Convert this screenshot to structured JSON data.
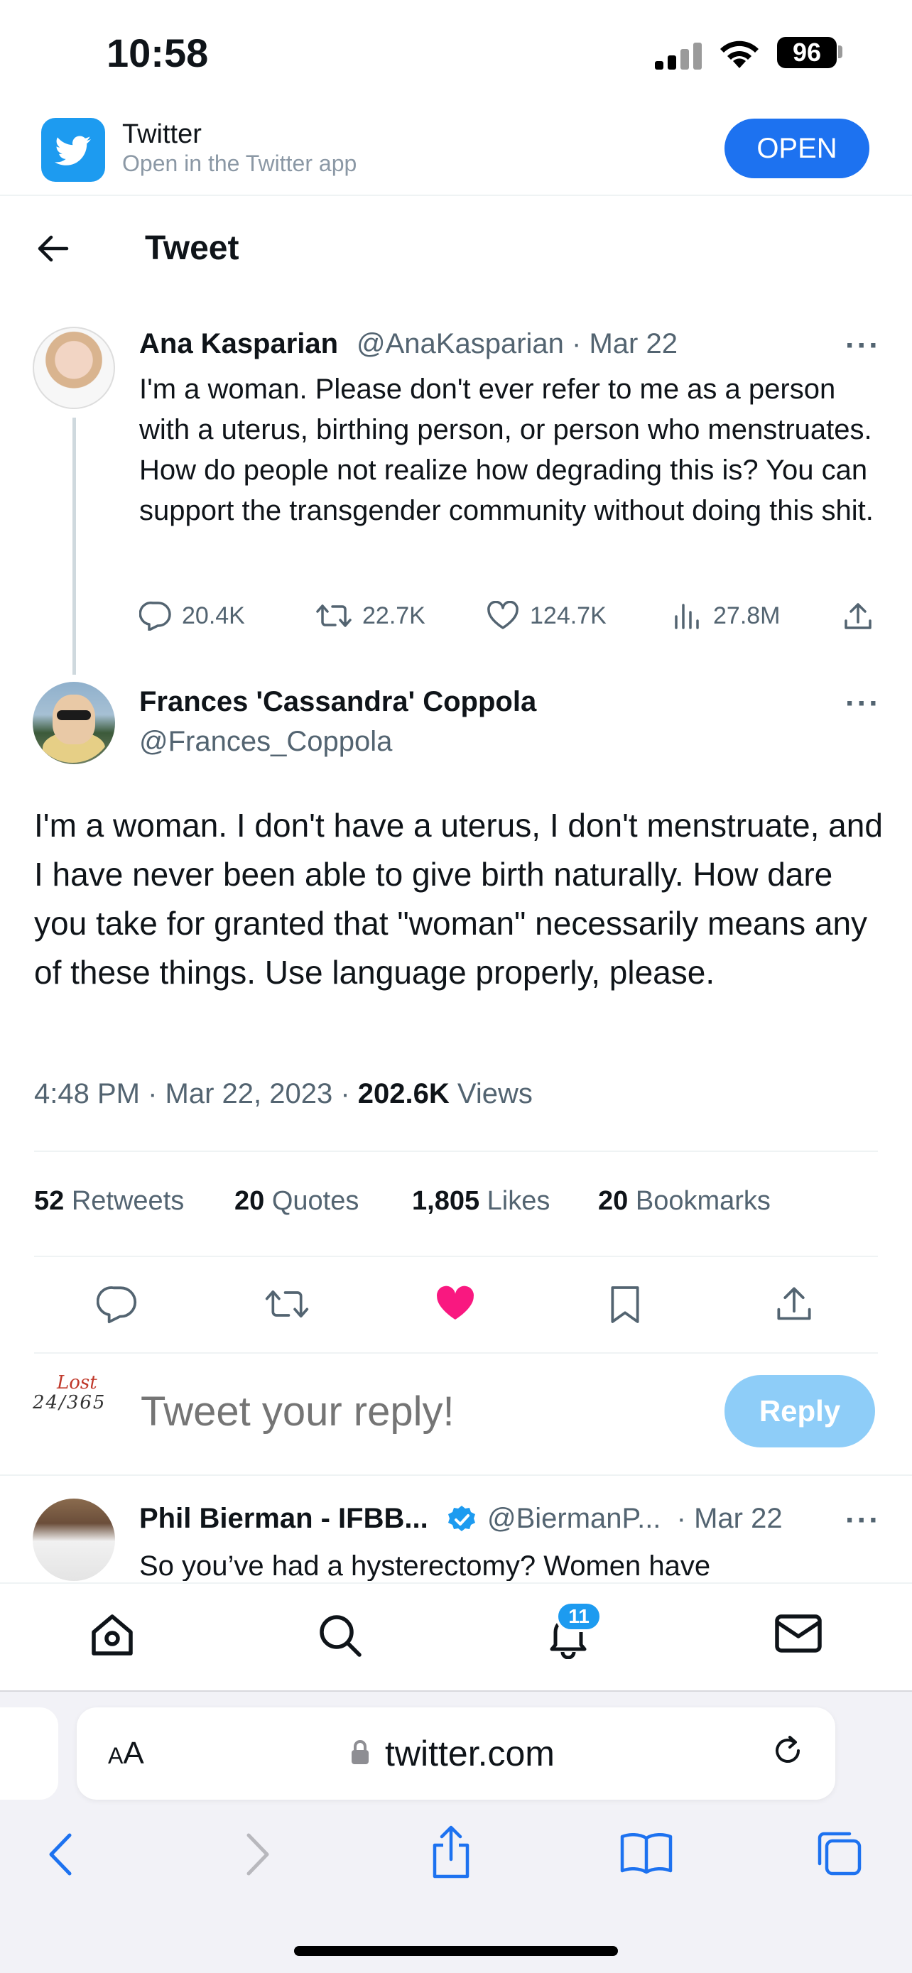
{
  "status_bar": {
    "time": "10:58",
    "battery": "96"
  },
  "banner": {
    "app_name": "Twitter",
    "subtitle": "Open in the Twitter app",
    "open_label": "OPEN"
  },
  "header": {
    "title": "Tweet"
  },
  "parent_tweet": {
    "name": "Ana Kasparian",
    "meta": "@AnaKasparian · Mar 22",
    "text": "I'm a woman. Please don't ever refer to me as a person with a uterus, birthing person, or person who menstruates. How do people not realize how degrading this is? You can support the transgender community without doing this shit.",
    "replies": "20.4K",
    "retweets": "22.7K",
    "likes": "124.7K",
    "views": "27.8M"
  },
  "main_tweet": {
    "name": "Frances 'Cassandra' Coppola",
    "handle": "@Frances_Coppola",
    "text": "I'm a woman. I don't have a uterus, I don't menstruate, and I have never been able to give birth naturally. How dare you take for granted that \"woman\" necessarily means any of these things. Use language properly, please.",
    "timestamp": "4:48 PM · Mar 22, 2023 · ",
    "views_count": "202.6K",
    "views_label": "Views",
    "stats": {
      "retweets_count": "52",
      "retweets_label": "Retweets",
      "quotes_count": "20",
      "quotes_label": "Quotes",
      "likes_count": "1,805",
      "likes_label": "Likes",
      "bookmarks_count": "20",
      "bookmarks_label": "Bookmarks"
    },
    "liked": true
  },
  "composer": {
    "placeholder": "Tweet your reply!",
    "reply_label": "Reply",
    "avatar_text_top": "Lost",
    "avatar_text_bottom": "24/365"
  },
  "reply_tweet": {
    "name": "Phil Bierman - IFBB...",
    "meta": "@BiermanP...  · Mar 22",
    "text": "So you’ve had a hysterectomy? Women have"
  },
  "bottom_nav": {
    "notification_count": "11"
  },
  "browser": {
    "aa_small": "A",
    "aa_large": "A",
    "url": "twitter.com"
  },
  "colors": {
    "accent": "#1d9bf0",
    "like": "#f91880",
    "open_button": "#1d72f0"
  }
}
